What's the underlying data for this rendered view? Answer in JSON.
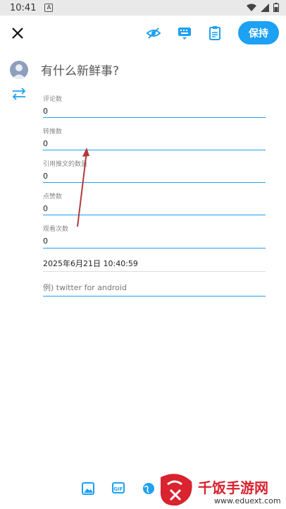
{
  "status_bar": {
    "time": "10:41",
    "a_badge": "A"
  },
  "toolbar": {
    "post_label": "保持"
  },
  "compose": {
    "placeholder": "有什么新鲜事?"
  },
  "fields": [
    {
      "label": "评论数",
      "value": "0"
    },
    {
      "label": "转推数",
      "value": "0"
    },
    {
      "label": "引用推文的数量",
      "value": "0"
    },
    {
      "label": "点赞数",
      "value": "0"
    },
    {
      "label": "观看次数",
      "value": "0"
    }
  ],
  "date_text": "2025年6月21日 10:40:59",
  "client": {
    "placeholder": "例) twitter for android"
  },
  "bottom_bar": {
    "gif_label": "GIF"
  },
  "watermark": {
    "name": "千饭手游网",
    "url": "www.eduext.com"
  },
  "colors": {
    "accent": "#1da1f2",
    "watermark_red": "#d9232f",
    "annotation_arrow": "#b23a3a"
  }
}
